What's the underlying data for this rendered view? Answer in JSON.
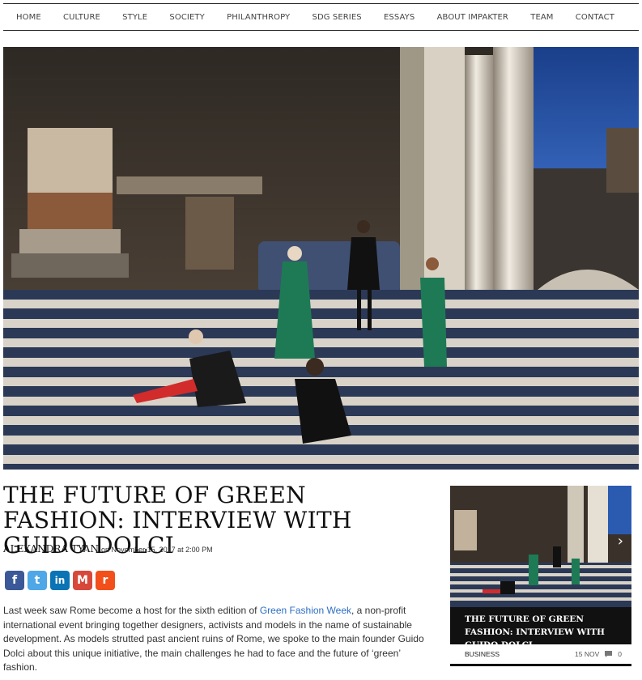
{
  "nav": {
    "items": [
      "HOME",
      "CULTURE",
      "STYLE",
      "SOCIETY",
      "PHILANTHROPY",
      "SDG SERIES",
      "ESSAYS",
      "ABOUT IMPAKTER",
      "TEAM",
      "CONTACT"
    ]
  },
  "article": {
    "title": "THE FUTURE OF GREEN FASHION: INTERVIEW WITH GUIDO DOLCI",
    "author": "ALEXANDRA TYAN",
    "date_text": "on November 15, 2017 at 2:00 PM",
    "body_before_link": "Last week saw Rome become a host for the sixth edition of ",
    "body_link": "Green Fashion Week",
    "body_after_link": ", a non-profit international event bringing together designers, activists and models in the name of sustainable development. As models strutted past ancient ruins of Rome, we spoke to the main founder Guido Dolci about this unique initiative, the main challenges he had to face and the future of ‘green’ fashion."
  },
  "share": {
    "icons": [
      "facebook-icon",
      "twitter-icon",
      "linkedin-icon",
      "gmail-icon",
      "reddit-icon"
    ],
    "glyphs": [
      "f",
      "t",
      "in",
      "M",
      "r"
    ]
  },
  "sidebar": {
    "caption": "THE FUTURE OF GREEN FASHION: INTERVIEW WITH GUIDO DOLCI",
    "category": "BUSINESS",
    "date": "15 NOV",
    "comments": "0",
    "arrow": "›"
  },
  "colors": {
    "sky": "#1f4e9c",
    "stone": "#d9d2c4",
    "link": "#2d6fc4",
    "dress_green": "#1e7a55"
  }
}
